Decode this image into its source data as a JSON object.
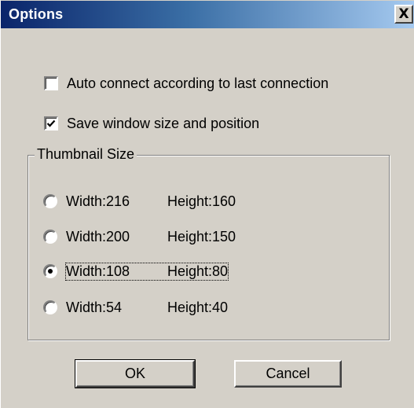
{
  "dialog": {
    "title": "Options",
    "close_glyph": "X"
  },
  "options": {
    "auto_connect": {
      "label": "Auto connect according to last connection",
      "checked": false
    },
    "save_window": {
      "label": "Save window size and position",
      "checked": true
    }
  },
  "thumbnail_group": {
    "legend": "Thumbnail Size",
    "choices": [
      {
        "width_label": "Width:216",
        "height_label": "Height:160",
        "selected": false
      },
      {
        "width_label": "Width:200",
        "height_label": "Height:150",
        "selected": false
      },
      {
        "width_label": "Width:108",
        "height_label": "Height:80",
        "selected": true
      },
      {
        "width_label": "Width:54",
        "height_label": "Height:40",
        "selected": false
      }
    ]
  },
  "buttons": {
    "ok": "OK",
    "cancel": "Cancel"
  },
  "colors": {
    "titlebar_start": "#0a246a",
    "titlebar_end": "#a6caf0",
    "face": "#d4d0c8"
  }
}
